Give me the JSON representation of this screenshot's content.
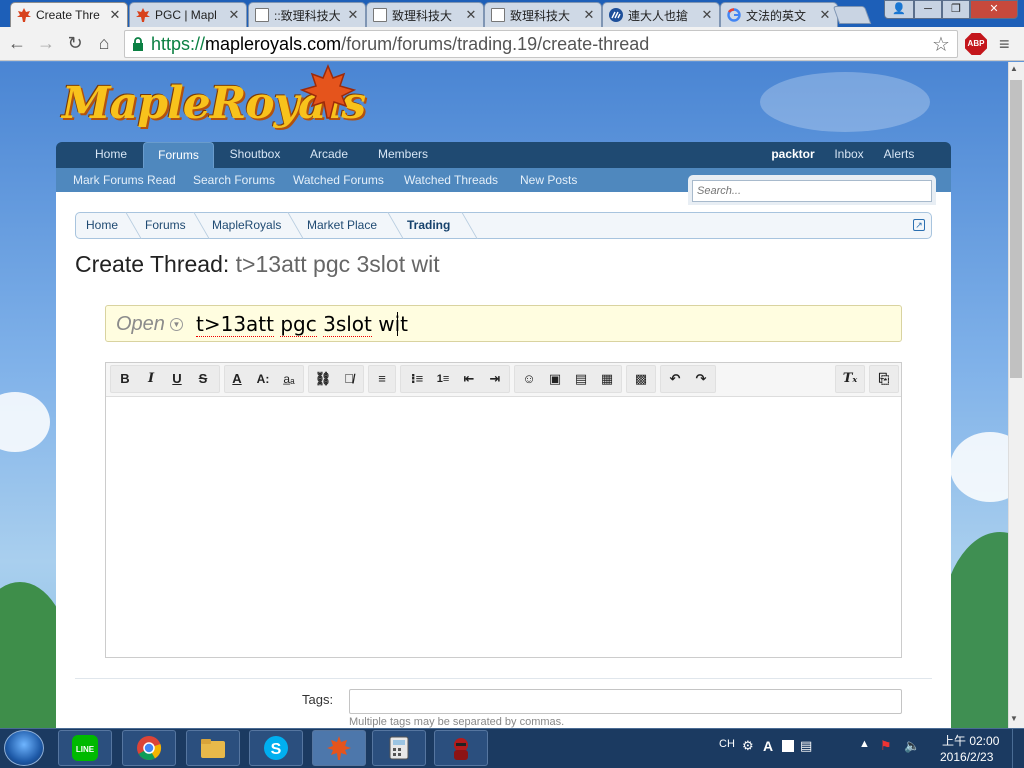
{
  "browser": {
    "tabs": [
      {
        "label": "Create Thre",
        "icon": "maple-leaf-icon"
      },
      {
        "label": "PGC | Mapl",
        "icon": "maple-leaf-icon"
      },
      {
        "label": "::致理科技大",
        "icon": "document-icon"
      },
      {
        "label": "致理科技大",
        "icon": "document-icon"
      },
      {
        "label": "致理科技大",
        "icon": "document-icon"
      },
      {
        "label": "連大人也搶",
        "icon": "blog-icon"
      },
      {
        "label": "文法的英文",
        "icon": "google-icon"
      }
    ],
    "url_scheme": "https://",
    "url_host": "mapleroyals.com",
    "url_path": "/forum/forums/trading.19/create-thread",
    "abp_label": "ABP"
  },
  "site": {
    "logo": "MapleRoyals",
    "nav_left": [
      "Home",
      "Forums",
      "Shoutbox",
      "Arcade",
      "Members"
    ],
    "nav_right": [
      "packtor",
      "Inbox",
      "Alerts"
    ],
    "subnav": [
      "Mark Forums Read",
      "Search Forums",
      "Watched Forums",
      "Watched Threads",
      "New Posts"
    ],
    "search_placeholder": "Search...",
    "breadcrumb": [
      "Home",
      "Forums",
      "MapleRoyals",
      "Market Place",
      "Trading"
    ]
  },
  "page": {
    "title_prefix": "Create Thread:",
    "title_suffix": "t>13att pgc 3slot wit",
    "prefix_label": "Open",
    "thread_title_a": "t>13att",
    "thread_title_b": "pgc",
    "thread_title_c": "3slot",
    "thread_title_d": "wit",
    "tags_label": "Tags:",
    "tags_hint": "Multiple tags may be separated by commas."
  },
  "editor_toolbar": [
    "bold",
    "italic",
    "underline",
    "strikethrough",
    "font-color",
    "font-size",
    "font-family",
    "link",
    "unlink",
    "align",
    "bullet-list",
    "number-list",
    "outdent",
    "indent",
    "smilies",
    "image",
    "media",
    "quote",
    "save-draft",
    "undo",
    "redo",
    "remove-format",
    "toggle-source"
  ],
  "taskbar": {
    "apps": [
      "LINE",
      "Chrome",
      "Explorer",
      "Skype",
      "MapleRoyals",
      "Calculator",
      "Ninja"
    ],
    "ime": "CH",
    "time": "上午 02:00",
    "date": "2016/2/23"
  },
  "colors": {
    "nav_dark": "#1f4a72",
    "nav_active": "#4f88be",
    "title_bg": "#fffde0",
    "logo": "#f8c21c"
  }
}
